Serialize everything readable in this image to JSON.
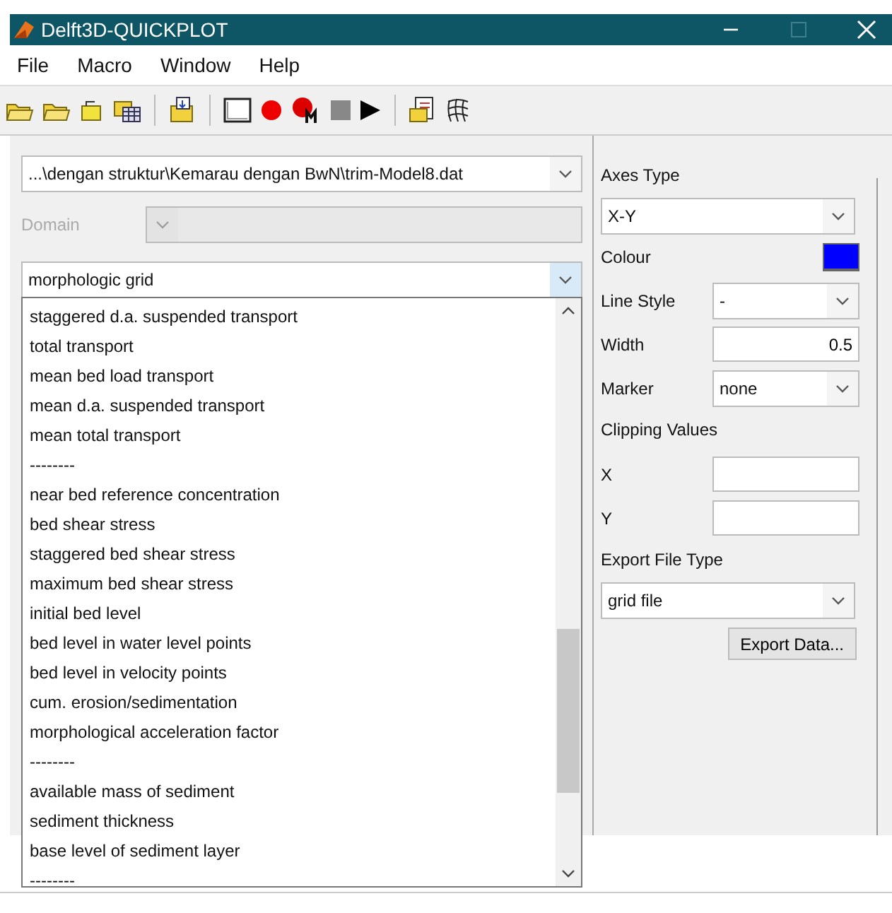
{
  "window": {
    "title": "Delft3D-QUICKPLOT"
  },
  "menu": [
    "File",
    "Macro",
    "Window",
    "Help"
  ],
  "file_select": {
    "value": "...\\dengan struktur\\Kemarau dengan BwN\\trim-Model8.dat"
  },
  "domain": {
    "label": "Domain",
    "disabled": true
  },
  "variable_select": {
    "value": "morphologic grid",
    "expanded": true
  },
  "variable_list": [
    {
      "text": "staggered d.a. suspended transport",
      "selected": false
    },
    {
      "text": "total transport",
      "selected": false
    },
    {
      "text": "mean bed load transport",
      "selected": false
    },
    {
      "text": "mean d.a. suspended transport",
      "selected": false
    },
    {
      "text": "mean total transport",
      "selected": false
    },
    {
      "text": "--------",
      "selected": false
    },
    {
      "text": "near bed reference concentration",
      "selected": false
    },
    {
      "text": "bed shear stress",
      "selected": false
    },
    {
      "text": "staggered bed shear stress",
      "selected": false
    },
    {
      "text": "maximum bed shear stress",
      "selected": false
    },
    {
      "text": "initial bed level",
      "selected": false
    },
    {
      "text": "bed level in water level points",
      "selected": false
    },
    {
      "text": "bed level in velocity points",
      "selected": false
    },
    {
      "text": "cum. erosion/sedimentation",
      "selected": false
    },
    {
      "text": "morphological acceleration factor",
      "selected": false
    },
    {
      "text": "--------",
      "selected": false
    },
    {
      "text": "available mass of sediment",
      "selected": false
    },
    {
      "text": "sediment thickness",
      "selected": false
    },
    {
      "text": "base level of sediment layer",
      "selected": false
    },
    {
      "text": "--------",
      "selected": false
    }
  ],
  "options": {
    "axes_type": {
      "label": "Axes Type",
      "value": "X-Y"
    },
    "colour": {
      "label": "Colour",
      "color": "#0000ff"
    },
    "line_style": {
      "label": "Line Style",
      "value": "-"
    },
    "width": {
      "label": "Width",
      "value": "0.5"
    },
    "marker": {
      "label": "Marker",
      "value": "none"
    },
    "clipping": {
      "label": "Clipping Values",
      "x_label": "X",
      "y_label": "Y"
    },
    "export_file_type": {
      "label": "Export File Type",
      "value": "grid file"
    },
    "export_button": "Export Data..."
  }
}
